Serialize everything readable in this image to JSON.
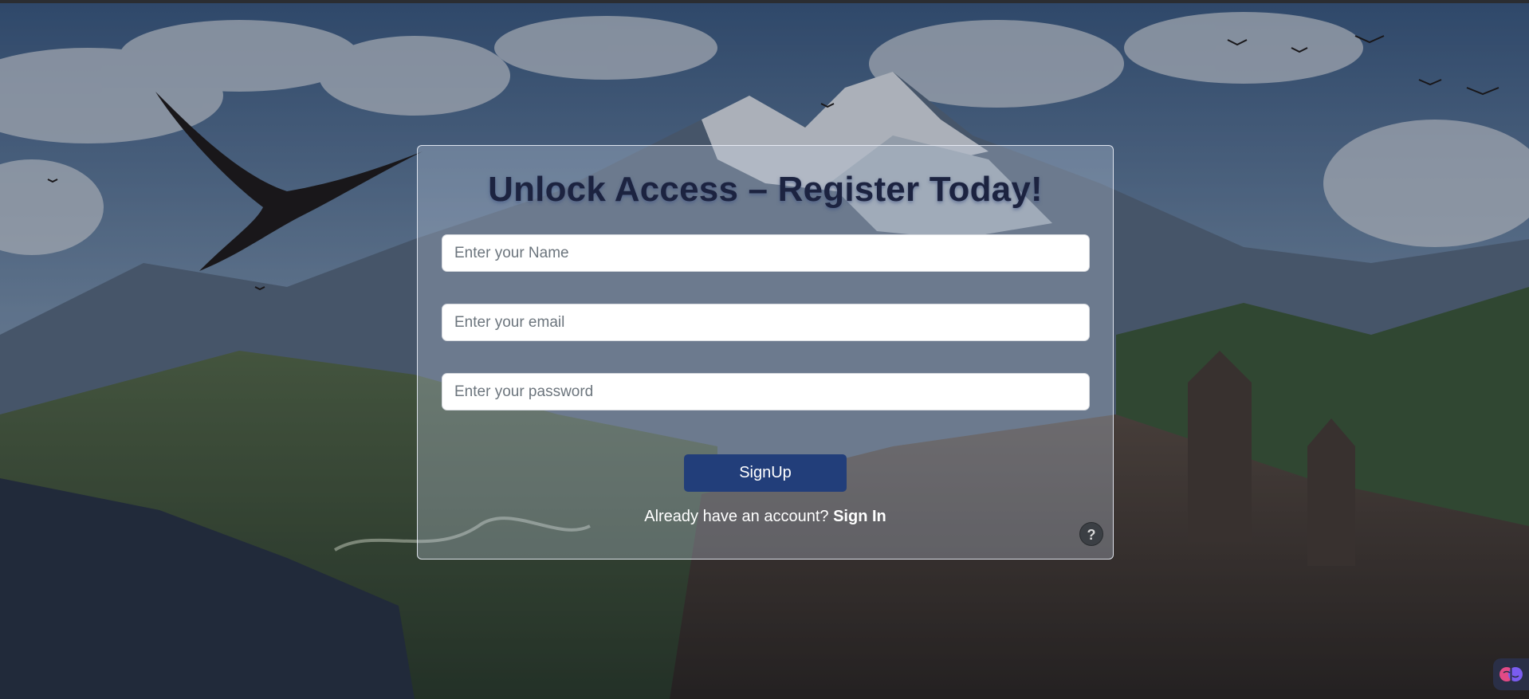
{
  "form": {
    "title": "Unlock Access – Register Today!",
    "name_placeholder": "Enter your Name",
    "email_placeholder": "Enter your email",
    "password_placeholder": "Enter your password",
    "signup_label": "SignUp",
    "signin_prompt": "Already have an account?",
    "signin_link": "Sign In"
  },
  "help": {
    "label": "?",
    "icon": "question-mark-icon"
  },
  "extension": {
    "icon": "brain-icon"
  },
  "colors": {
    "title": "#1c2340",
    "signup_button": "#223e7a",
    "card_border": "#ebf0f8"
  }
}
